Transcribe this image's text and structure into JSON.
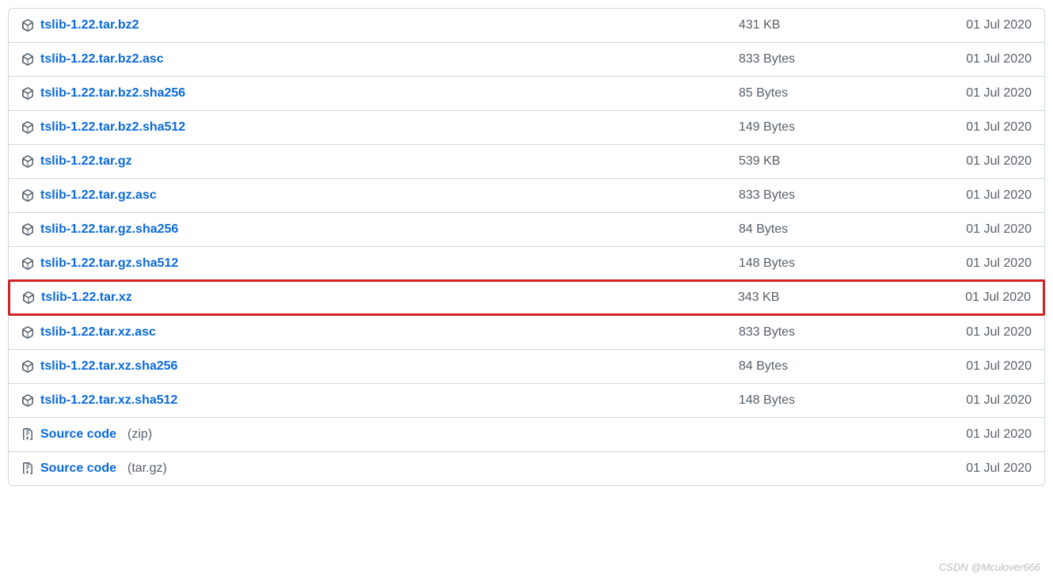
{
  "icons": {
    "package": "package-icon",
    "zip": "zip-icon"
  },
  "source_code_label": "Source code",
  "assets": [
    {
      "name": "tslib-1.22.tar.bz2",
      "size": "431 KB",
      "date": "01 Jul 2020",
      "icon": "package",
      "highlight": false
    },
    {
      "name": "tslib-1.22.tar.bz2.asc",
      "size": "833 Bytes",
      "date": "01 Jul 2020",
      "icon": "package",
      "highlight": false
    },
    {
      "name": "tslib-1.22.tar.bz2.sha256",
      "size": "85 Bytes",
      "date": "01 Jul 2020",
      "icon": "package",
      "highlight": false
    },
    {
      "name": "tslib-1.22.tar.bz2.sha512",
      "size": "149 Bytes",
      "date": "01 Jul 2020",
      "icon": "package",
      "highlight": false
    },
    {
      "name": "tslib-1.22.tar.gz",
      "size": "539 KB",
      "date": "01 Jul 2020",
      "icon": "package",
      "highlight": false
    },
    {
      "name": "tslib-1.22.tar.gz.asc",
      "size": "833 Bytes",
      "date": "01 Jul 2020",
      "icon": "package",
      "highlight": false
    },
    {
      "name": "tslib-1.22.tar.gz.sha256",
      "size": "84 Bytes",
      "date": "01 Jul 2020",
      "icon": "package",
      "highlight": false
    },
    {
      "name": "tslib-1.22.tar.gz.sha512",
      "size": "148 Bytes",
      "date": "01 Jul 2020",
      "icon": "package",
      "highlight": false
    },
    {
      "name": "tslib-1.22.tar.xz",
      "size": "343 KB",
      "date": "01 Jul 2020",
      "icon": "package",
      "highlight": true
    },
    {
      "name": "tslib-1.22.tar.xz.asc",
      "size": "833 Bytes",
      "date": "01 Jul 2020",
      "icon": "package",
      "highlight": false
    },
    {
      "name": "tslib-1.22.tar.xz.sha256",
      "size": "84 Bytes",
      "date": "01 Jul 2020",
      "icon": "package",
      "highlight": false
    },
    {
      "name": "tslib-1.22.tar.xz.sha512",
      "size": "148 Bytes",
      "date": "01 Jul 2020",
      "icon": "package",
      "highlight": false
    },
    {
      "name": "Source code",
      "ext": "(zip)",
      "size": "",
      "date": "01 Jul 2020",
      "icon": "zip",
      "source": true,
      "highlight": false
    },
    {
      "name": "Source code",
      "ext": "(tar.gz)",
      "size": "",
      "date": "01 Jul 2020",
      "icon": "zip",
      "source": true,
      "highlight": false
    }
  ],
  "watermark": "CSDN @Mculover666"
}
